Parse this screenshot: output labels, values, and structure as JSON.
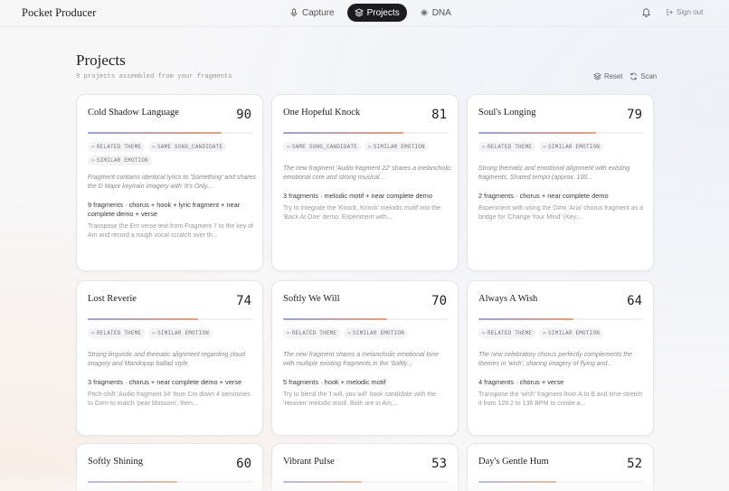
{
  "app": {
    "brand": "Pocket Producer",
    "nav": [
      {
        "label": "Capture",
        "icon": "mic-icon",
        "active": false
      },
      {
        "label": "Projects",
        "icon": "layers-icon",
        "active": true
      },
      {
        "label": "DNA",
        "icon": "sparkle-icon",
        "active": false
      }
    ],
    "signout_label": "Sign out"
  },
  "page": {
    "title": "Projects",
    "subtitle": "9 projects assembled from your fragments",
    "reset_label": "Reset",
    "scan_label": "Scan"
  },
  "colors": {
    "accent_dark": "#1c1c20",
    "bar_gradient_start": "#9aa3d6",
    "bar_gradient_end": "#e8a07c"
  },
  "projects": [
    {
      "title": "Cold Shadow Language",
      "score": "90",
      "score_value": 90,
      "tags": [
        "RELATED THEME",
        "SAME SONG_CANDIDATE",
        "SIMILAR EMOTION"
      ],
      "reason": "Fragment contains identical lyrics to 'Something' and shares the D Major key/rain imagery with 'It's Only...",
      "meta": "9 fragments · chorus + hook + lyric fragment + near complete demo + verse",
      "suggest": "Transpose the Em verse text from Fragment 7 to the key of Am and record a rough vocal scratch over th..."
    },
    {
      "title": "One Hopeful Knock",
      "score": "81",
      "score_value": 81,
      "tags": [
        "SAME SONG_CANDIDATE",
        "SIMILAR EMOTION"
      ],
      "reason": "The new fragment 'Audio fragment 22' shares a melancholic emotional core and strong musical...",
      "meta": "3 fragments · melodic motif + near complete demo",
      "suggest": "Try to integrate the 'Knock, Knock' melodic motif into the 'Back At One' demo. Experiment with..."
    },
    {
      "title": "Soul's Longing",
      "score": "79",
      "score_value": 79,
      "tags": [
        "RELATED THEME",
        "SIMILAR EMOTION"
      ],
      "reason": "Strong thematic and emotional alignment with existing fragments. Shared tempo (approx. 100...",
      "meta": "2 fragments · chorus + near complete demo",
      "suggest": "Experiment with using the G#m 'Aria' chorus fragment as a bridge for 'Change Your Mind' (Key:..."
    },
    {
      "title": "Lost Reverie",
      "score": "74",
      "score_value": 74,
      "tags": [
        "RELATED THEME",
        "SIMILAR EMOTION"
      ],
      "reason": "Strong linguistic and thematic alignment regarding cloud imagery and Mandopop ballad style.",
      "meta": "3 fragments · chorus + near complete demo + verse",
      "suggest": "Pitch-shift 'Audio fragment 34' from Cm down 4 semitones to G#m to match 'pear blossom', then..."
    },
    {
      "title": "Softly We Will",
      "score": "70",
      "score_value": 70,
      "tags": [
        "RELATED THEME",
        "SIMILAR EMOTION"
      ],
      "reason": "The new fragment shares a melancholic emotional tone with multiple existing fragments in the 'Softly...",
      "meta": "5 fragments · hook + melodic motif",
      "suggest": "Try to blend the 'I will, you will' hook candidate with the 'Heaven' melodic motif. Both are in Am,..."
    },
    {
      "title": "Always A Wish",
      "score": "64",
      "score_value": 64,
      "tags": [
        "RELATED THEME",
        "SIMILAR EMOTION"
      ],
      "reason": "The new celebratory chorus perfectly complements the themes in 'wish', sharing imagery of flying and...",
      "meta": "4 fragments · chorus + verse",
      "suggest": "Transpose the 'wish' fragment from A to B and time-stretch it from 129.2 to 136 BPM to create a..."
    },
    {
      "title": "Softly Shining",
      "score": "60",
      "score_value": 60,
      "tags": [],
      "reason": "",
      "meta": "",
      "suggest": ""
    },
    {
      "title": "Vibrant Pulse",
      "score": "53",
      "score_value": 53,
      "tags": [],
      "reason": "",
      "meta": "",
      "suggest": ""
    },
    {
      "title": "Day's Gentle Hum",
      "score": "52",
      "score_value": 52,
      "tags": [],
      "reason": "",
      "meta": "",
      "suggest": ""
    }
  ]
}
